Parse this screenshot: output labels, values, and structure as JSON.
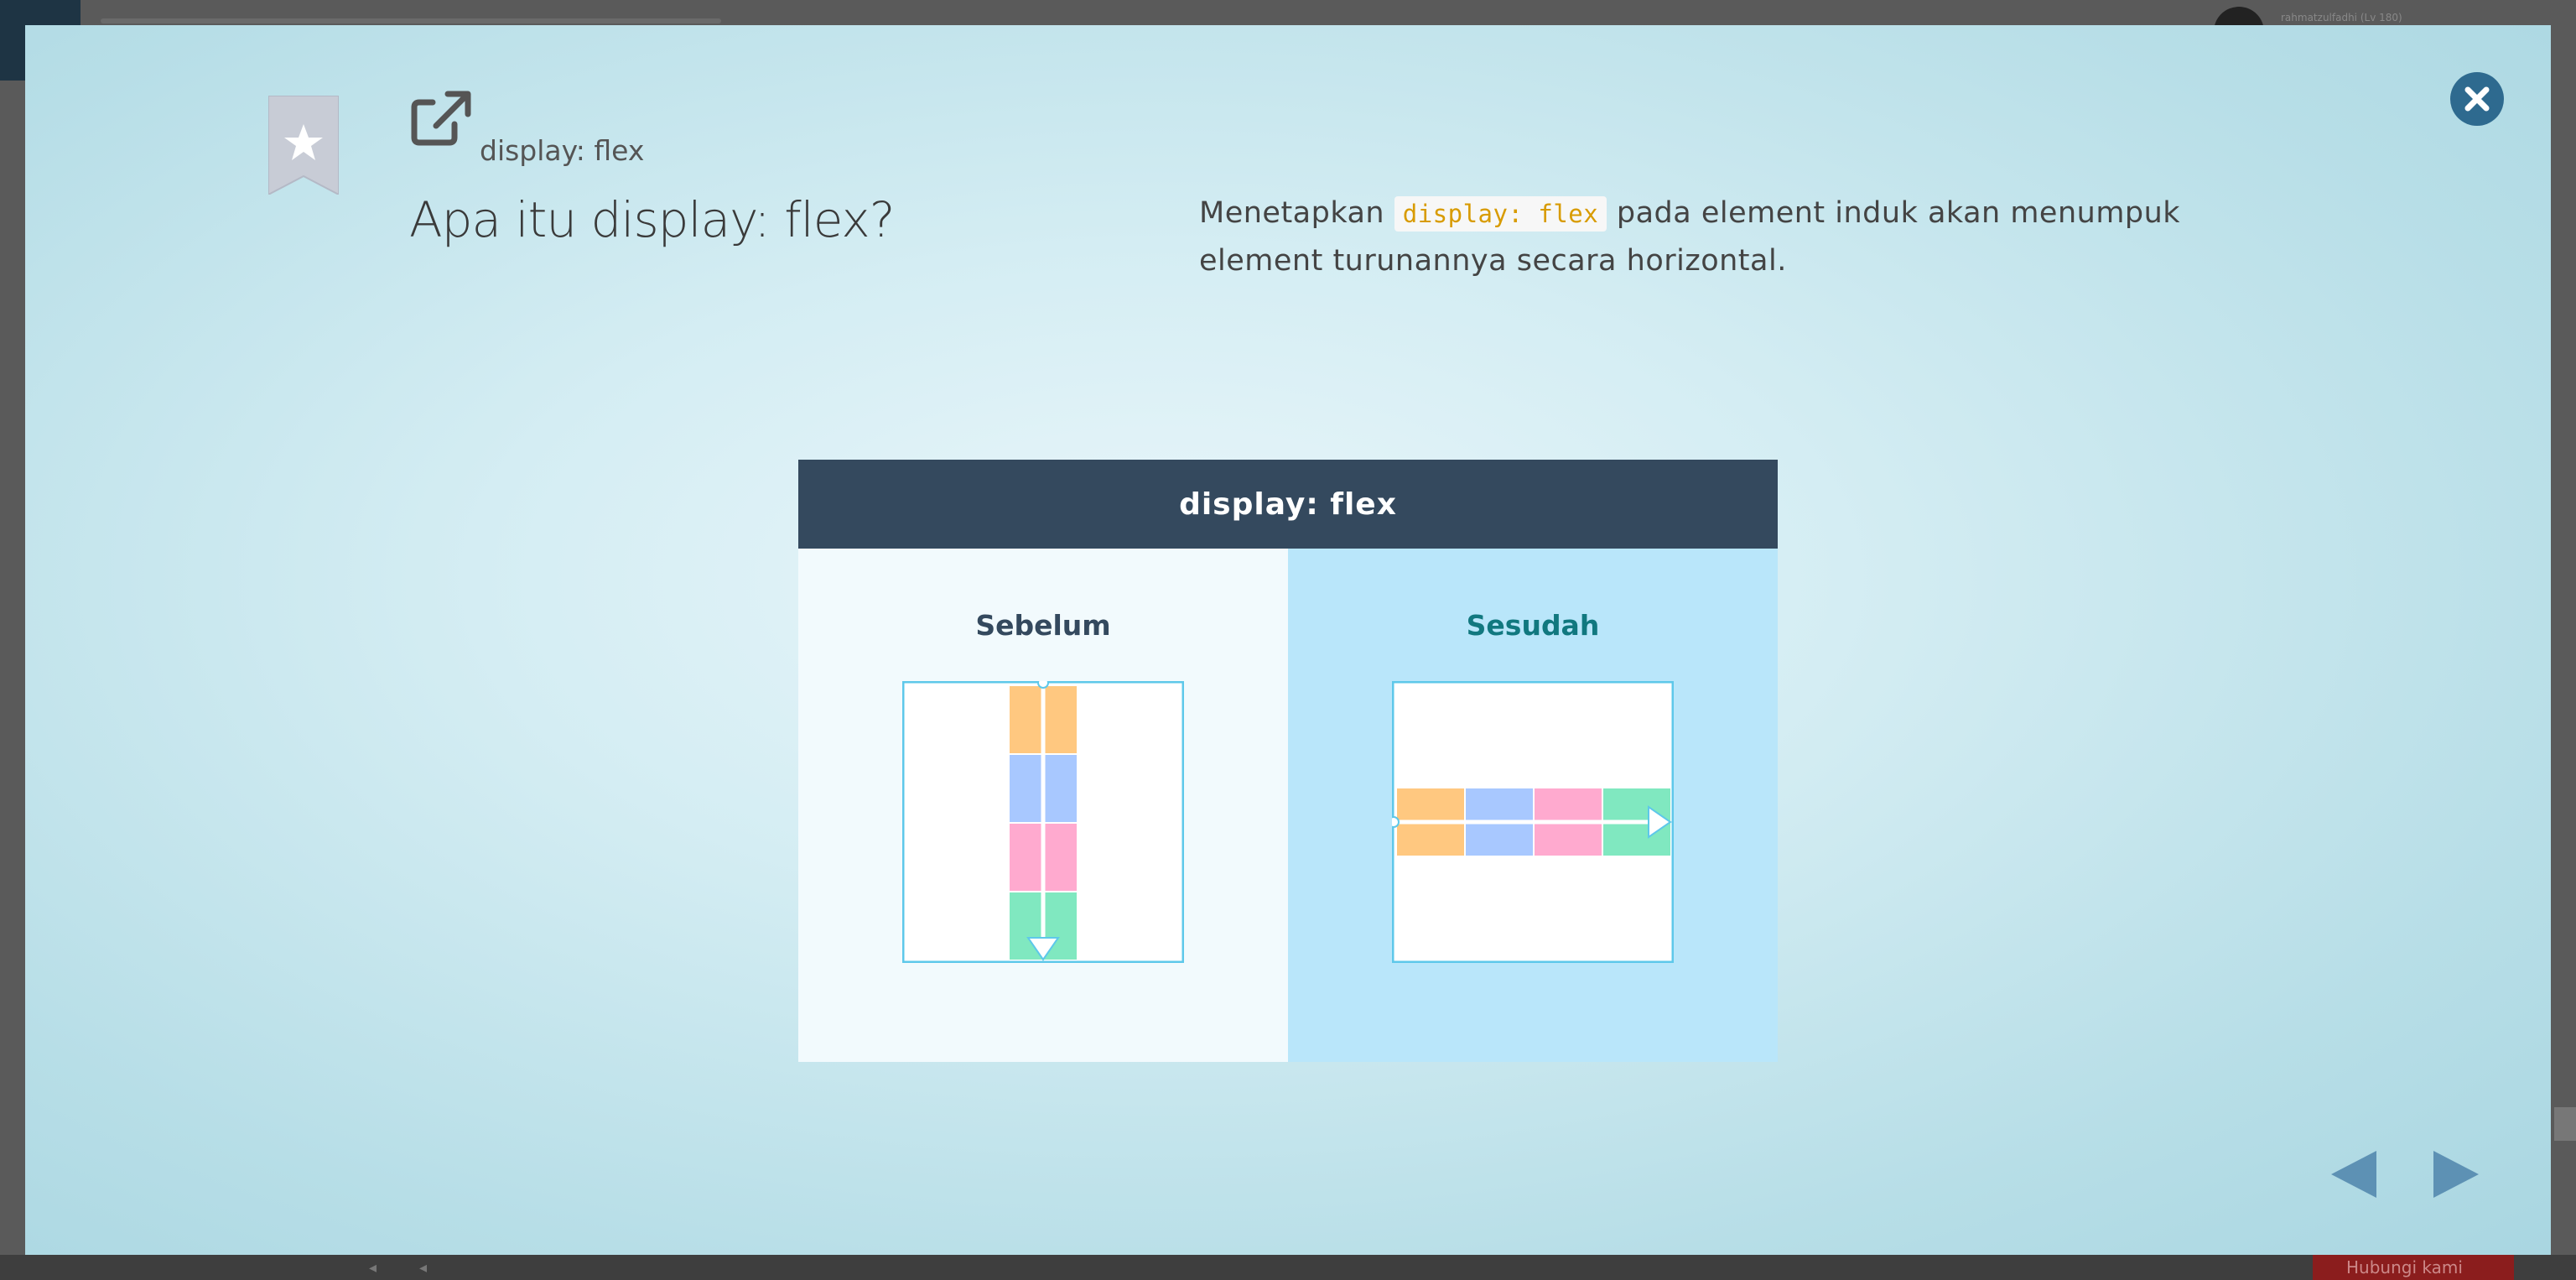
{
  "background": {
    "user_label": "rahmatzulfadhi (Lv 180)",
    "help_button": "Hubungi kami"
  },
  "modal": {
    "breadcrumb": "display: flex",
    "title": "Apa itu display: flex?",
    "description": {
      "before_code": "Menetapkan ",
      "code": "display: flex",
      "after_code": " pada element induk akan menumpuk element turunannya secara horizontal."
    },
    "illustration": {
      "header": "display: flex",
      "before_label": "Sebelum",
      "after_label": "Sesudah"
    }
  },
  "icons": {
    "bookmark": "bookmark-star-icon",
    "external": "external-link-icon",
    "close": "close-icon",
    "prev": "prev-arrow-icon",
    "next": "next-arrow-icon"
  },
  "colors": {
    "accent": "#2e6a8f",
    "header": "#34495e",
    "code": "#d89b00",
    "box_orange": "#ffc880",
    "box_blue": "#a8c8ff",
    "box_pink": "#ffaacf",
    "box_green": "#80e8c0",
    "frame": "#5ec8ea"
  }
}
